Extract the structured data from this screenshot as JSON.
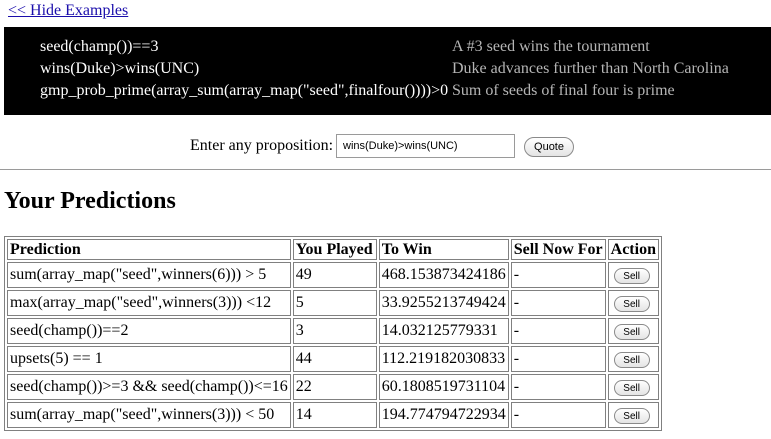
{
  "hide_examples_label": "<< Hide Examples",
  "examples": [
    {
      "expr": "seed(champ())==3",
      "desc": "A #3 seed wins the tournament"
    },
    {
      "expr": "wins(Duke)>wins(UNC)",
      "desc": "Duke advances further than North Carolina"
    },
    {
      "expr": "gmp_prob_prime(array_sum(array_map(\"seed\",finalfour())))>0",
      "desc": "Sum of seeds of final four is prime"
    }
  ],
  "proposition": {
    "label": "Enter any proposition:",
    "value": "wins(Duke)>wins(UNC)",
    "button": "Quote"
  },
  "predictions": {
    "title": "Your Predictions",
    "columns": [
      "Prediction",
      "You Played",
      "To Win",
      "Sell Now For",
      "Action"
    ],
    "rows": [
      {
        "prediction": "sum(array_map(\"seed\",winners(6))) > 5",
        "played": "49",
        "to_win": "468.153873424186",
        "sell_for": "-",
        "action": "Sell"
      },
      {
        "prediction": "max(array_map(\"seed\",winners(3))) <12",
        "played": "5",
        "to_win": "33.9255213749424",
        "sell_for": "-",
        "action": "Sell"
      },
      {
        "prediction": "seed(champ())==2",
        "played": "3",
        "to_win": "14.032125779331",
        "sell_for": "-",
        "action": "Sell"
      },
      {
        "prediction": "upsets(5) == 1",
        "played": "44",
        "to_win": "112.219182030833",
        "sell_for": "-",
        "action": "Sell"
      },
      {
        "prediction": "seed(champ())>=3 && seed(champ())<=16",
        "played": "22",
        "to_win": "60.1808519731104",
        "sell_for": "-",
        "action": "Sell"
      },
      {
        "prediction": "sum(array_map(\"seed\",winners(3))) < 50",
        "played": "14",
        "to_win": "194.774794722934",
        "sell_for": "-",
        "action": "Sell"
      }
    ]
  }
}
